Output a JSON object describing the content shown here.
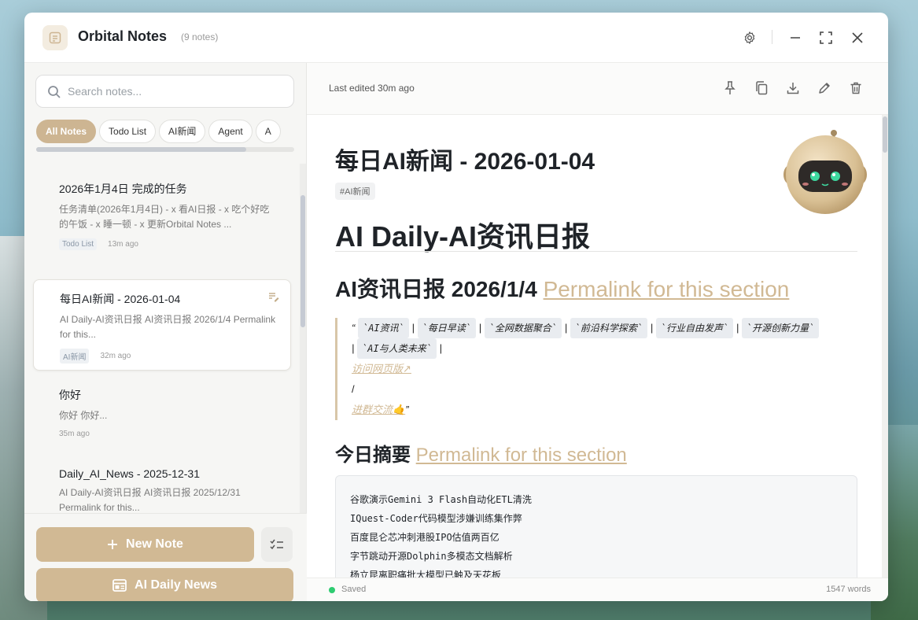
{
  "app": {
    "title": "Orbital Notes",
    "note_count": "(9 notes)"
  },
  "search": {
    "placeholder": "Search notes..."
  },
  "filters": [
    {
      "label": "All Notes",
      "active": true
    },
    {
      "label": "Todo List",
      "active": false
    },
    {
      "label": "AI新闻",
      "active": false
    },
    {
      "label": "Agent",
      "active": false
    },
    {
      "label": "A",
      "active": false
    }
  ],
  "notes": [
    {
      "title": "2026年1月4日 完成的任务",
      "preview": "任务清单(2026年1月4日) - x 看AI日报 - x 吃个好吃的午饭 - x 睡一顿 - x 更新Orbital Notes ...",
      "tag": "Todo List",
      "time": "13m ago"
    },
    {
      "title": "每日AI新闻 - 2026-01-04",
      "preview": "AI Daily-AI资讯日报 AI资讯日报 2026/1/4 Permalink for this...",
      "tag": "AI新闻",
      "time": "32m ago",
      "selected": true
    },
    {
      "title": "你好",
      "preview": "你好 你好...",
      "tag": "",
      "time": "35m ago"
    },
    {
      "title": "Daily_AI_News - 2025-12-31",
      "preview": "AI Daily-AI资讯日报 AI资讯日报 2025/12/31 Permalink for this...",
      "tag": "",
      "time": ""
    }
  ],
  "buttons": {
    "new_note": "New Note",
    "ai_daily_news": "AI Daily News"
  },
  "editor": {
    "last_edited": "Last edited 30m ago",
    "doc_title": "每日AI新闻 - 2026-01-04",
    "doc_tag": "#AI新闻",
    "h1": "AI Daily-AI资讯日报",
    "h2": "AI资讯日报 2026/1/4",
    "h3": "今日摘要",
    "permalink": "Permalink for this section",
    "quote": {
      "open": "“",
      "codes": [
        "`AI资讯`",
        "`每日早读`",
        "`全网数据聚合`",
        "`前沿科学探索`",
        "`行业自由发声`",
        "`开源创新力量`",
        "`AI与人类未来`"
      ],
      "sep": "|",
      "link1": "访问网页版↗",
      "slash": "/",
      "link2": "进群交流🤙",
      "close": "”"
    },
    "summary_lines": [
      "谷歌演示Gemini 3 Flash自动化ETL清洗",
      "IQuest-Coder代码模型涉嫌训练集作弊",
      "百度昆仑芯冲刺港股IPO估值两百亿",
      "字节跳动开源Dolphin多模态文档解析",
      "杨立昆离职痛批大模型已触及天花板"
    ]
  },
  "status": {
    "saved": "Saved",
    "words": "1547 words"
  },
  "colors": {
    "accent": "#d1b994",
    "saved_dot": "#2ecc71"
  }
}
